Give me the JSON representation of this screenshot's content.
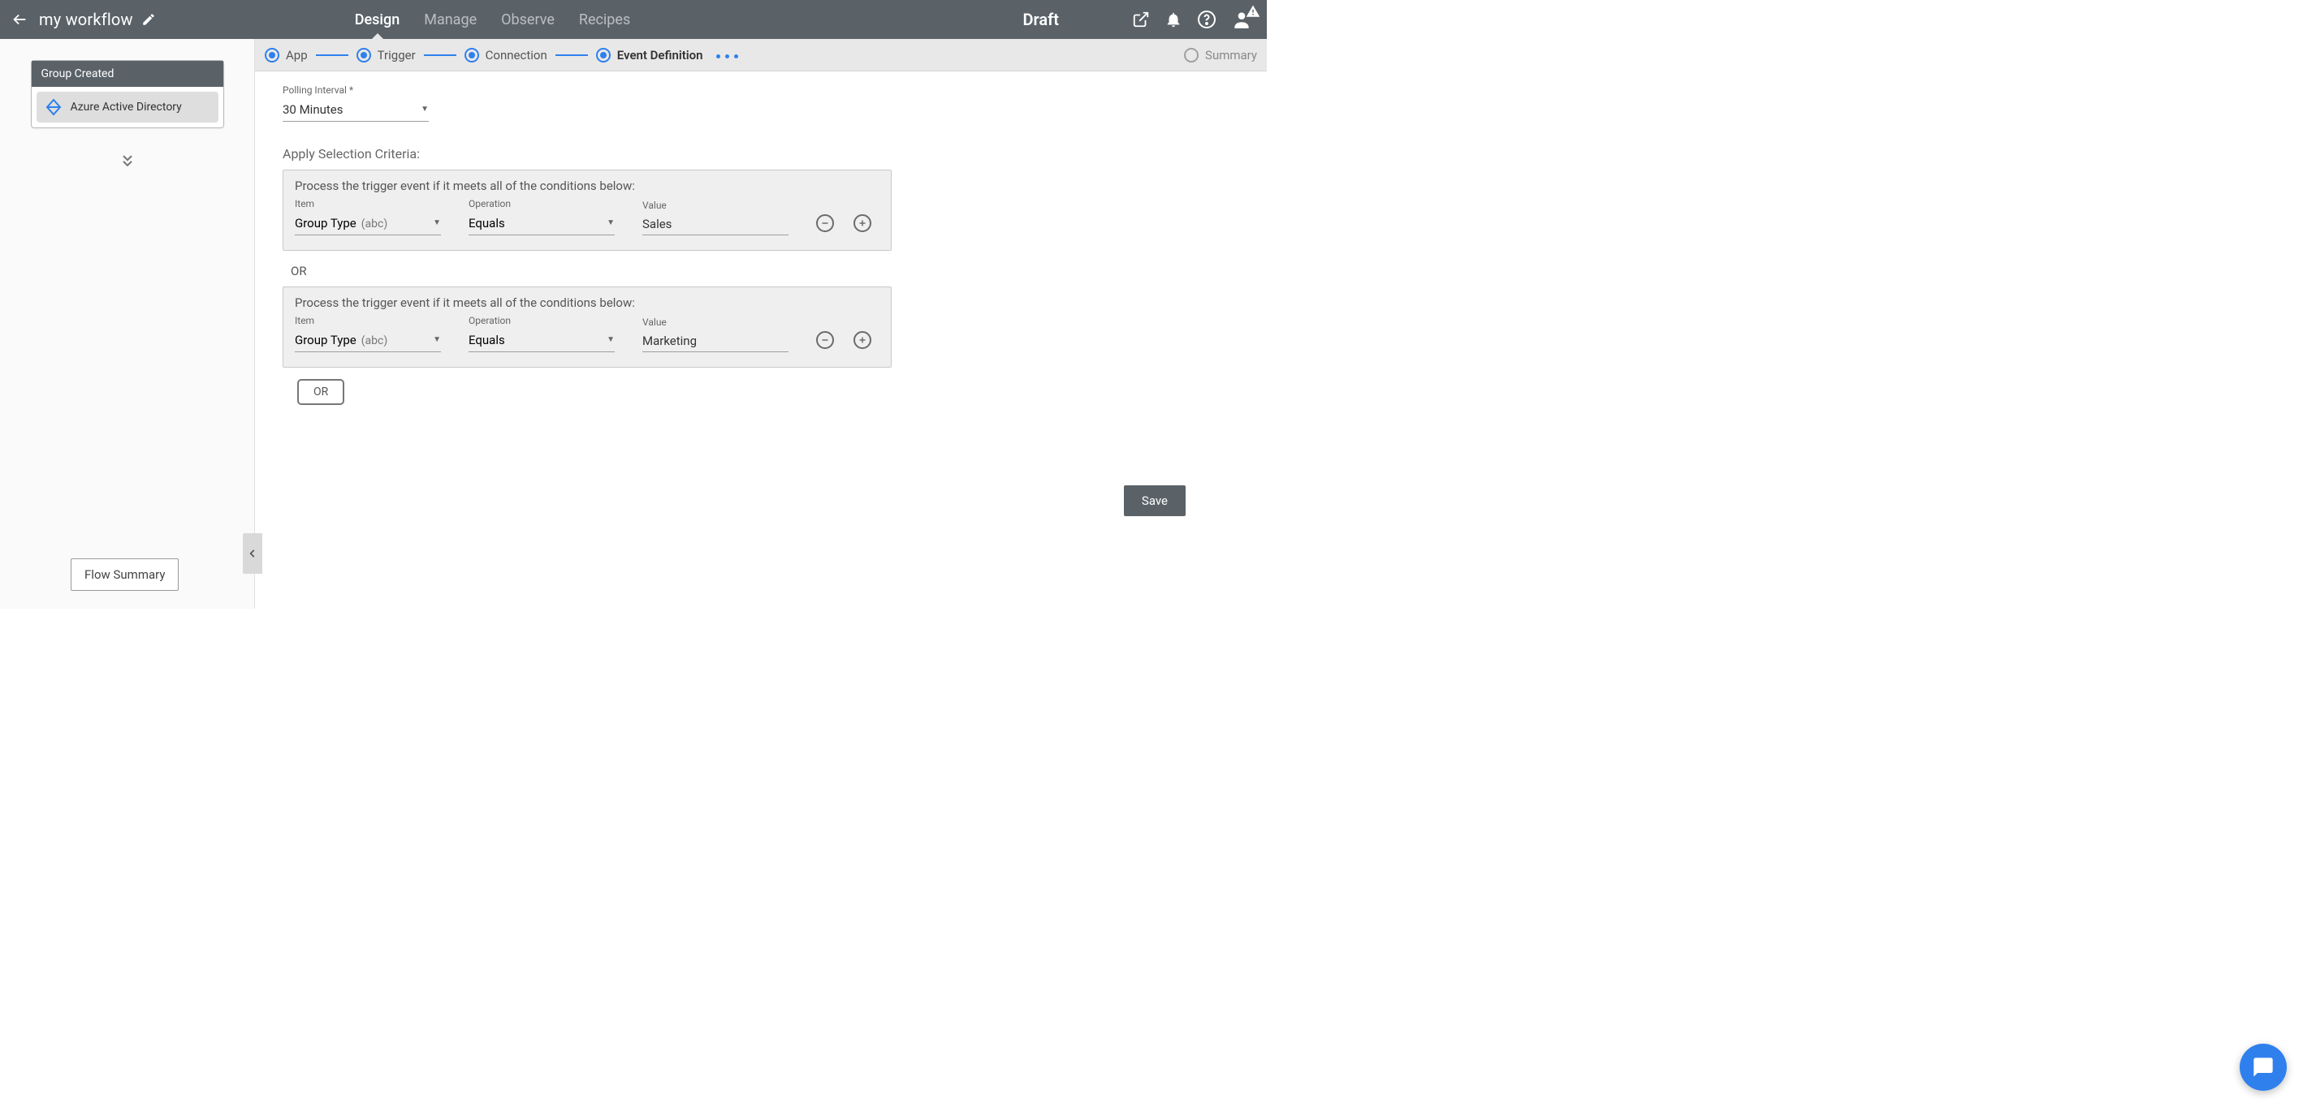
{
  "header": {
    "workflow_title": "my workflow",
    "status": "Draft",
    "tabs": {
      "design": "Design",
      "manage": "Manage",
      "observe": "Observe",
      "recipes": "Recipes"
    }
  },
  "sidebar": {
    "node_title": "Group Created",
    "node_app": "Azure Active Directory",
    "flow_summary_btn": "Flow Summary"
  },
  "stepper": {
    "app": "App",
    "trigger": "Trigger",
    "connection": "Connection",
    "event_def": "Event Definition",
    "summary": "Summary"
  },
  "form": {
    "polling_label": "Polling Interval",
    "polling_value": "30 Minutes",
    "criteria_title": "Apply Selection Criteria:",
    "box_heading": "Process the trigger event if it meets all of the conditions below:",
    "labels": {
      "item": "Item",
      "operation": "Operation",
      "value": "Value"
    },
    "item_hint": "(abc)",
    "or_separator": "OR",
    "or_button": "OR",
    "save": "Save",
    "rows": [
      {
        "item": "Group Type",
        "operation": "Equals",
        "value": "Sales"
      },
      {
        "item": "Group Type",
        "operation": "Equals",
        "value": "Marketing"
      }
    ]
  }
}
